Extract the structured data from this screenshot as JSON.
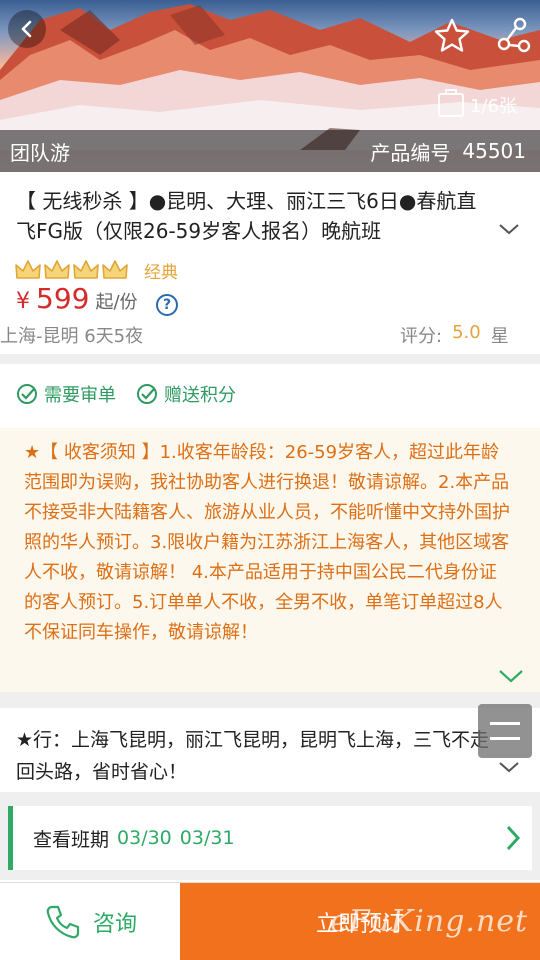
{
  "hero": {
    "image_counter": "1/6张",
    "category": "团队游",
    "product_id_label": "产品编号",
    "product_id_value": "45501"
  },
  "product": {
    "title": "【 无线秒杀 】●昆明、大理、丽江三飞6日●春航直飞FG版（仅限26-59岁客人报名）晚航班",
    "crown_count": 4,
    "grade": "经典",
    "price_currency": "¥",
    "price_value": "599",
    "price_unit": "起/份",
    "help_symbol": "?",
    "route": "上海-昆明  6天5夜",
    "rating_label": "评分:",
    "rating_value": "5.0",
    "rating_unit": "星"
  },
  "tags": {
    "tag1": "需要审单",
    "tag2": "赠送积分"
  },
  "notice": {
    "text": "★【 收客须知 】1.收客年龄段：26-59岁客人，超过此年龄范围即为误购，我社协助客人进行换退！敬请谅解。2.本产品不接受非大陆籍客人、旅游从业人员，不能听懂中文持外国护照的华人预订。3.限收户籍为江苏浙江上海客人，其他区域客人不收，敬请谅解！ 4.本产品适用于持中国公民二代身份证的客人预订。5.订单单人不收，全男不收，单笔订单超过8人不保证同车操作，敬请谅解！"
  },
  "itinerary": {
    "text": "★行：上海飞昆明，丽江飞昆明，昆明飞上海，三飞不走回头路，省时省心！"
  },
  "schedule": {
    "label": "查看班期",
    "date1": "03/30",
    "date2": "03/31"
  },
  "bottom": {
    "consult_label": "咨询",
    "book_label": "立即预订",
    "watermark": "eFuKing.net"
  },
  "colors": {
    "accent_green": "#2faa66",
    "price_red": "#d52b2b",
    "notice_orange": "#dd6f16",
    "book_orange": "#f2711c",
    "gold": "#e7a33b"
  }
}
